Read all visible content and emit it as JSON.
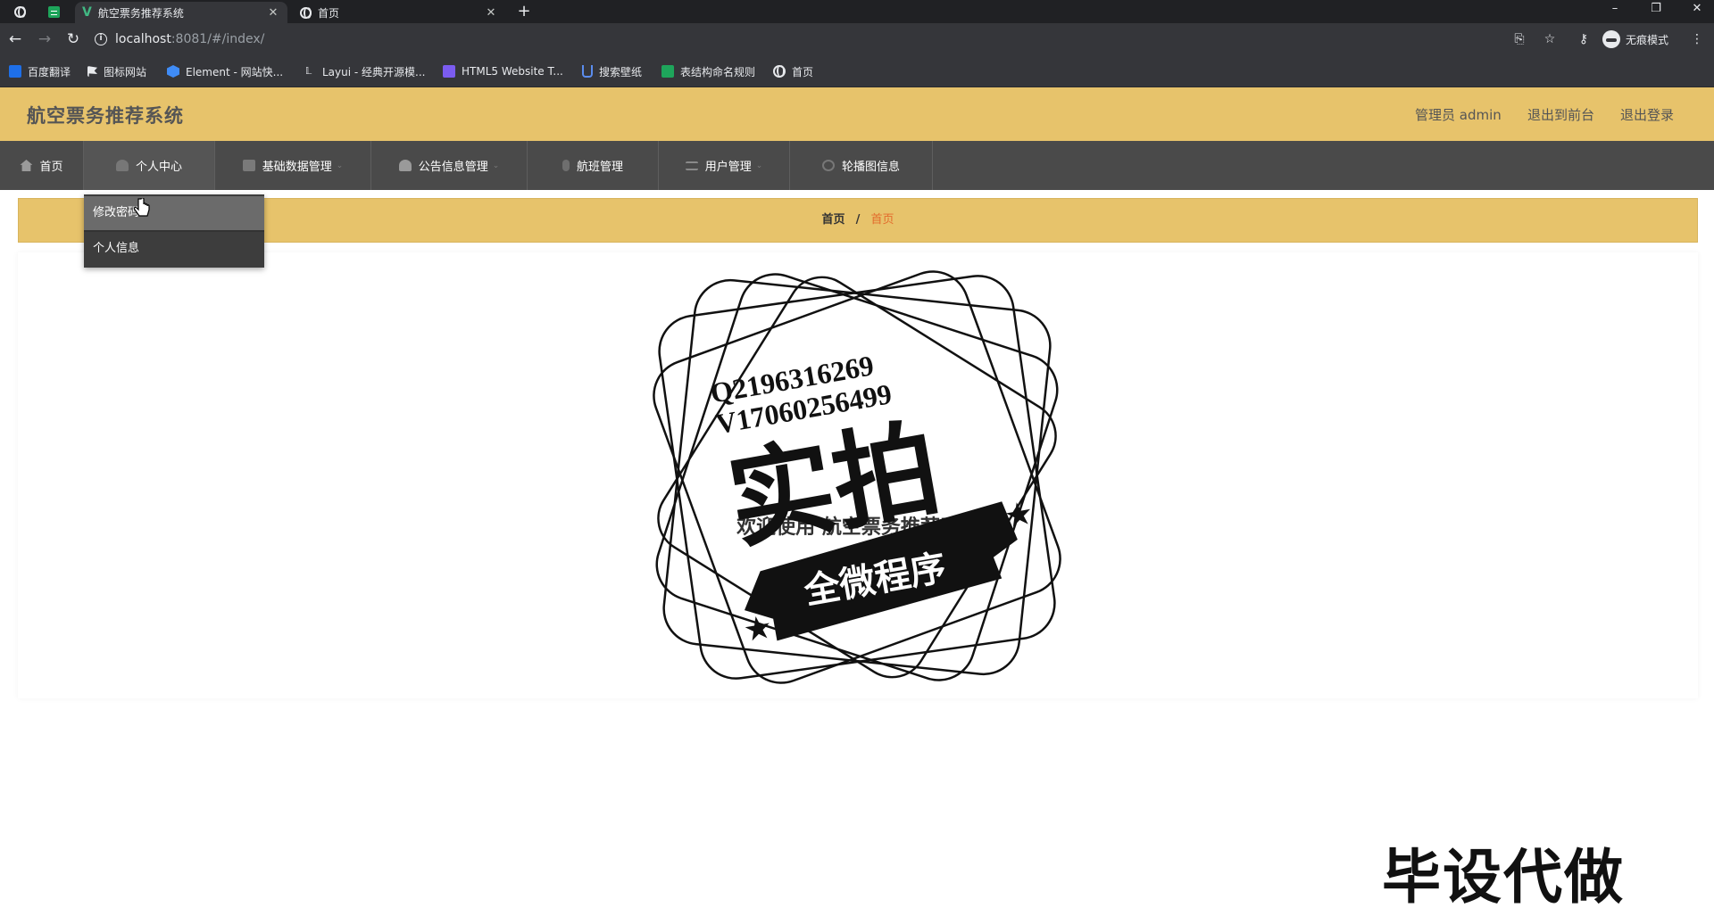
{
  "browser": {
    "tabs": [
      {
        "title": "航空票务推荐系统",
        "active": true
      },
      {
        "title": "首页",
        "active": false
      }
    ],
    "url_host": "localhost",
    "url_rest": ":8081/#/index/",
    "incognito_label": "无痕模式",
    "bookmarks": [
      {
        "label": "百度翻译",
        "color": "#1e6fe8"
      },
      {
        "label": "图标网站",
        "color": "#ffffff"
      },
      {
        "label": "Element - 网站快...",
        "color": "#3f8cf7"
      },
      {
        "label": "Layui - 经典开源模...",
        "color": "#e8eaed"
      },
      {
        "label": "HTML5 Website T...",
        "color": "#7b5cf0"
      },
      {
        "label": "搜索壁纸",
        "color": "#2f6de8"
      },
      {
        "label": "表结构命名规则",
        "color": "#1ea55b"
      },
      {
        "label": "首页",
        "color": "#e8eaed"
      }
    ]
  },
  "header": {
    "title": "航空票务推荐系统",
    "admin_label": "管理员 admin",
    "back_front_label": "退出到前台",
    "logout_label": "退出登录"
  },
  "menu": [
    {
      "label": "首页",
      "icon": "home-icon",
      "has_caret": false
    },
    {
      "label": "个人中心",
      "icon": "user-icon",
      "has_caret": false
    },
    {
      "label": "基础数据管理",
      "icon": "clipboard-icon",
      "has_caret": true
    },
    {
      "label": "公告信息管理",
      "icon": "user-icon",
      "has_caret": true
    },
    {
      "label": "航班管理",
      "icon": "mic-icon",
      "has_caret": false
    },
    {
      "label": "用户管理",
      "icon": "list-icon",
      "has_caret": true
    },
    {
      "label": "轮播图信息",
      "icon": "gear-icon",
      "has_caret": false
    }
  ],
  "dropdown": {
    "items": [
      {
        "label": "修改密码"
      },
      {
        "label": "个人信息"
      }
    ]
  },
  "breadcrumb": {
    "home": "首页",
    "separator": "/",
    "current": "首页"
  },
  "main": {
    "welcome": "欢迎使用 航空票务推荐系统"
  },
  "watermark": {
    "line1": "Q2196316269",
    "line2": "V17060256499",
    "big": "实拍",
    "ribbon": "全微程序",
    "corner": "毕设代做"
  },
  "colors": {
    "header_bg": "#e7c36b",
    "menu_bg": "#4a4a4a",
    "breadcrumb_current": "#e36b2c"
  }
}
